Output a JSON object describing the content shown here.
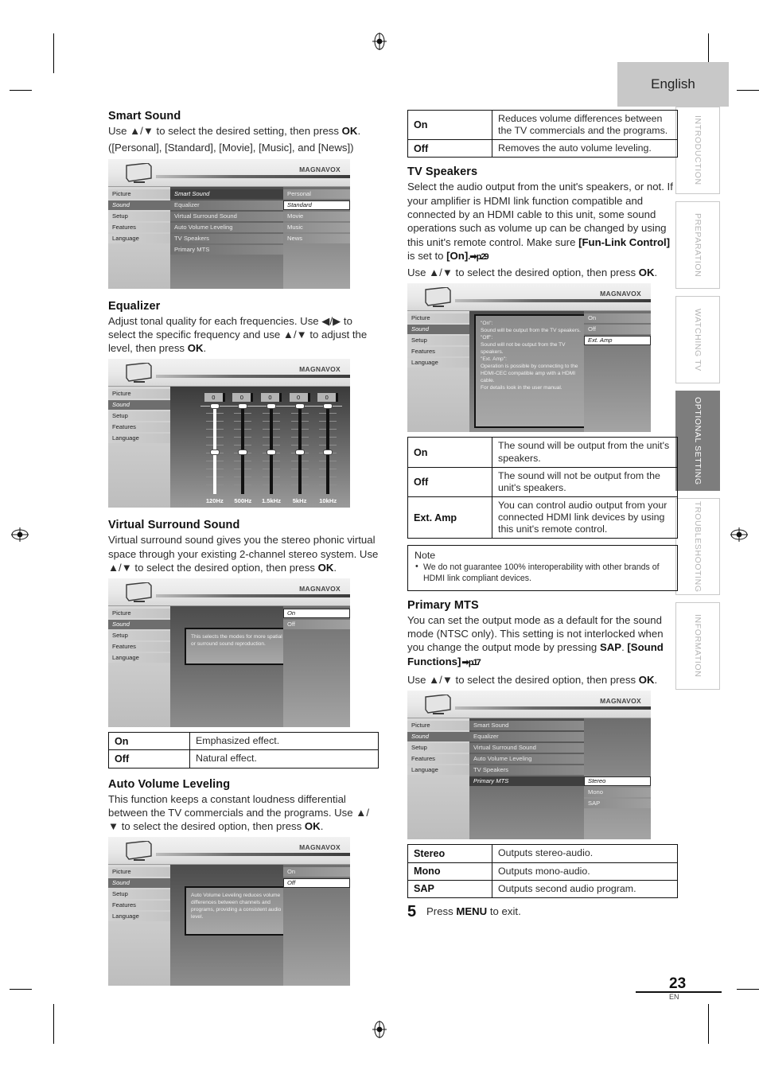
{
  "page": {
    "language_tab": "English",
    "number": "23",
    "number_sub": "EN"
  },
  "side_tabs": [
    {
      "label": "INTRODUCTION",
      "active": false
    },
    {
      "label": "PREPARATION",
      "active": false
    },
    {
      "label": "WATCHING TV",
      "active": false
    },
    {
      "label": "OPTIONAL SETTING",
      "active": true
    },
    {
      "label": "TROUBLESHOOTING",
      "active": false
    },
    {
      "label": "INFORMATION",
      "active": false
    }
  ],
  "osd_common": {
    "logo": "MAGNAVOX",
    "left_menu": [
      "Picture",
      "Sound",
      "Setup",
      "Features",
      "Language"
    ],
    "selected_left": "Sound"
  },
  "smart_sound": {
    "heading": "Smart Sound",
    "body_1": "Use ▲/▼ to select the desired setting, then press ",
    "body_1_b": "OK",
    "body_1_end": ".",
    "body_2": "([Personal], [Standard], [Movie], [Music], and [News])",
    "menu_items": [
      "Smart Sound",
      "Equalizer",
      "Virtual Surround Sound",
      "Auto Volume Leveling",
      "TV Speakers",
      "Primary MTS"
    ],
    "selected_item": "Smart Sound",
    "options": [
      "Personal",
      "Standard",
      "Movie",
      "Music",
      "News"
    ],
    "selected_option": "Standard"
  },
  "equalizer": {
    "heading": "Equalizer",
    "body": "Adjust tonal quality for each frequencies. Use ◀/▶ to select the specific frequency and use ▲/▼ to adjust the level, then press ",
    "body_b": "OK",
    "body_end": ".",
    "bands": [
      {
        "label": "120Hz",
        "value": "0"
      },
      {
        "label": "500Hz",
        "value": "0"
      },
      {
        "label": "1.5kHz",
        "value": "0"
      },
      {
        "label": "5kHz",
        "value": "0"
      },
      {
        "label": "10kHz",
        "value": "0"
      }
    ]
  },
  "virtual_surround": {
    "heading": "Virtual Surround Sound",
    "body": "Virtual surround sound gives you the stereo phonic virtual space through your existing 2-channel stereo system. Use ▲/▼ to select the desired option, then press ",
    "body_b": "OK",
    "body_end": ".",
    "tooltip": "This selects the modes for more spatial or surround sound reproduction.",
    "options": [
      "On",
      "Off"
    ],
    "selected_option": "On",
    "table": [
      {
        "key": "On",
        "value": "Emphasized effect."
      },
      {
        "key": "Off",
        "value": "Natural effect."
      }
    ]
  },
  "auto_volume": {
    "heading": "Auto Volume Leveling",
    "body": "This function keeps a constant loudness differential between the TV commercials and the programs. Use ▲/▼ to select the desired option, then press ",
    "body_b": "OK",
    "body_end": ".",
    "tooltip": "Auto Volume Leveling reduces volume differences between channels and programs, providing a consistent audio level.",
    "options": [
      "On",
      "Off"
    ],
    "selected_option": "Off",
    "table": [
      {
        "key": "On",
        "value": "Reduces volume differences between the TV commercials and the programs."
      },
      {
        "key": "Off",
        "value": "Removes the auto volume leveling."
      }
    ]
  },
  "tv_speakers": {
    "heading": "TV Speakers",
    "body_1": "Select the audio output from the unit's speakers, or not. If your amplifier is HDMI link function compatible and connected by an HDMI cable to this unit, some sound operations such as volume up can be changed by using this unit's remote control. Make sure ",
    "body_1_b1": "[Fun-Link Control]",
    "body_1_mid": " is set to ",
    "body_1_b2": "[On]",
    "body_1_ref": ". ➡ p.29",
    "body_2": "Use ▲/▼ to select the desired option, then press ",
    "body_2_b": "OK",
    "body_2_end": ".",
    "tooltip": "\"On\":\nSound will be output from the TV speakers.\n\"Off\":\nSound will not be output from the TV speakers.\n\"Ext. Amp\":\nOperation is possible by connecting to the HDMI-CEC compatible amp with a HDMI cable.\nFor details look in the user manual.",
    "options": [
      "On",
      "Off",
      "Ext. Amp"
    ],
    "selected_option": "Ext. Amp",
    "table": [
      {
        "key": "On",
        "value": "The sound will be output from the unit's speakers."
      },
      {
        "key": "Off",
        "value": "The sound will not be output from the unit's speakers."
      },
      {
        "key": "Ext. Amp",
        "value": "You can control audio output from your connected HDMI link devices by using this unit's remote control."
      }
    ]
  },
  "note": {
    "title": "Note",
    "items": [
      "We do not guarantee 100% interoperability with other brands of HDMI link compliant devices."
    ]
  },
  "primary_mts": {
    "heading": "Primary MTS",
    "body_1": "You can set the output mode as a default for the sound mode (NTSC only). This setting is not interlocked when you change the output mode by pressing ",
    "body_1_b1": "SAP",
    "body_1_mid": ". ",
    "body_1_b2": "[Sound Functions]",
    "body_1_ref": " ➡ p.17",
    "body_2": "Use ▲/▼ to select the desired option, then press ",
    "body_2_b": "OK",
    "body_2_end": ".",
    "menu_items": [
      "Smart Sound",
      "Equalizer",
      "Virtual Surround Sound",
      "Auto Volume Leveling",
      "TV Speakers",
      "Primary MTS"
    ],
    "selected_item": "Primary MTS",
    "options": [
      "Stereo",
      "Mono",
      "SAP"
    ],
    "selected_option": "Stereo",
    "table": [
      {
        "key": "Stereo",
        "value": "Outputs stereo-audio."
      },
      {
        "key": "Mono",
        "value": "Outputs mono-audio."
      },
      {
        "key": "SAP",
        "value": "Outputs second audio program."
      }
    ]
  },
  "footer_step": {
    "number": "5",
    "text_pre": "Press ",
    "text_b": "MENU",
    "text_post": " to exit."
  }
}
